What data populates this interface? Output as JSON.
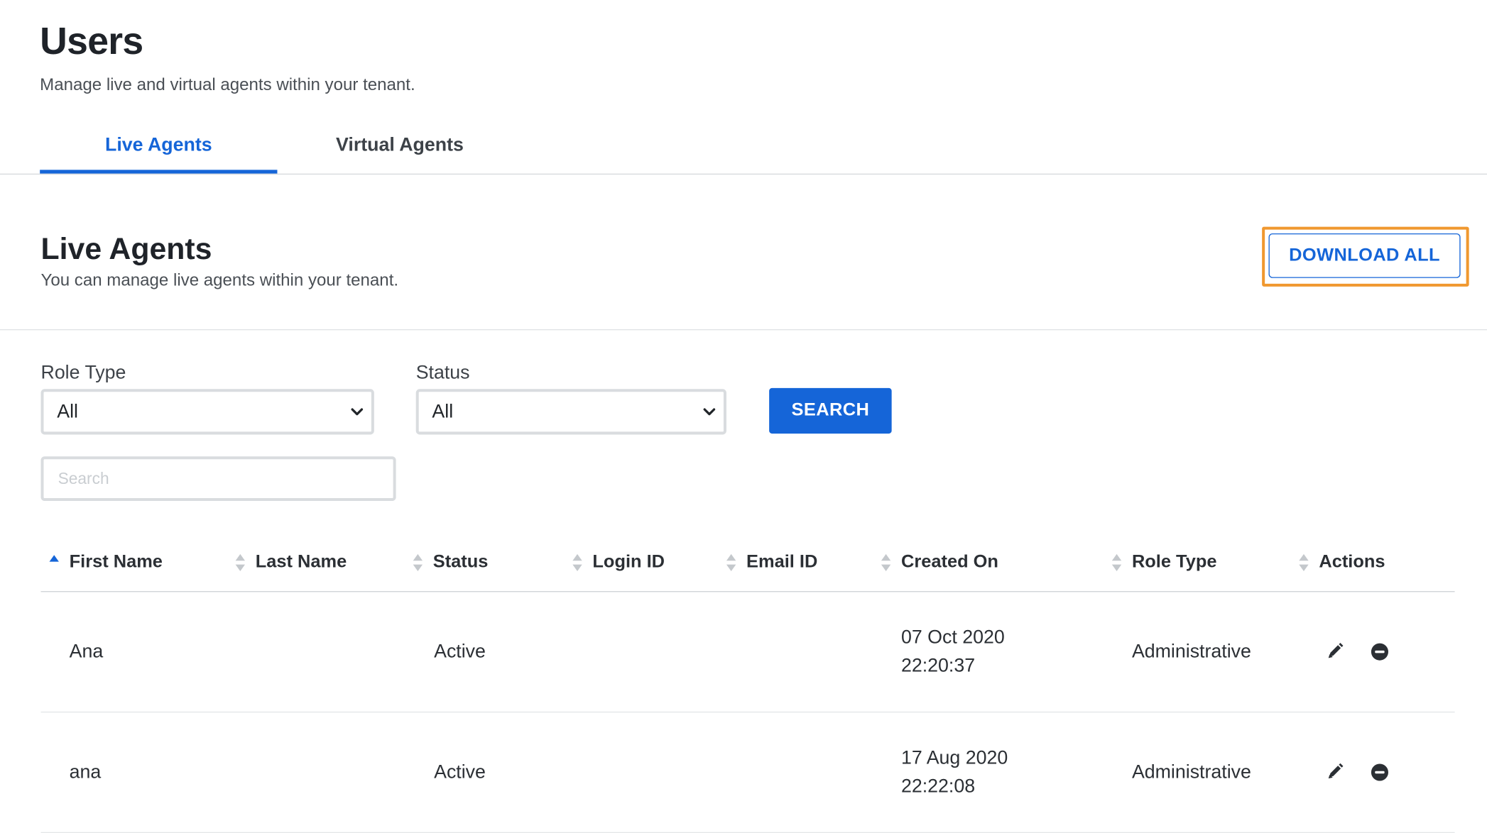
{
  "page": {
    "title": "Users",
    "subtitle": "Manage live and virtual agents within your tenant."
  },
  "tabs": [
    {
      "label": "Live Agents",
      "active": true
    },
    {
      "label": "Virtual Agents",
      "active": false
    }
  ],
  "section": {
    "title": "Live Agents",
    "subtitle": "You can manage live agents within your tenant.",
    "download_label": "DOWNLOAD ALL"
  },
  "filters": {
    "role_type": {
      "label": "Role Type",
      "value": "All"
    },
    "status": {
      "label": "Status",
      "value": "All"
    },
    "search_button": "SEARCH",
    "search_placeholder": "Search"
  },
  "table": {
    "columns": [
      "First Name",
      "Last Name",
      "Status",
      "Login ID",
      "Email ID",
      "Created On",
      "Role Type",
      "Actions"
    ],
    "sorted_column": "First Name",
    "rows": [
      {
        "first_name": "Ana",
        "last_name": "",
        "status": "Active",
        "login_id": "",
        "email_id": "",
        "created_date": "07 Oct 2020",
        "created_time": "22:20:37",
        "role_type": "Administrative"
      },
      {
        "first_name": "ana",
        "last_name": "",
        "status": "Active",
        "login_id": "",
        "email_id": "",
        "created_date": "17 Aug 2020",
        "created_time": "22:22:08",
        "role_type": "Administrative"
      }
    ]
  },
  "icons": {
    "sort": "sort-icon",
    "sort_asc": "sort-ascending-icon",
    "edit": "pencil-icon",
    "remove": "minus-circle-icon",
    "dropdown": "chevron-down-icon"
  },
  "colors": {
    "accent": "#1565d8",
    "highlight": "#f0982f",
    "sort_inactive": "#c4c8cc"
  }
}
